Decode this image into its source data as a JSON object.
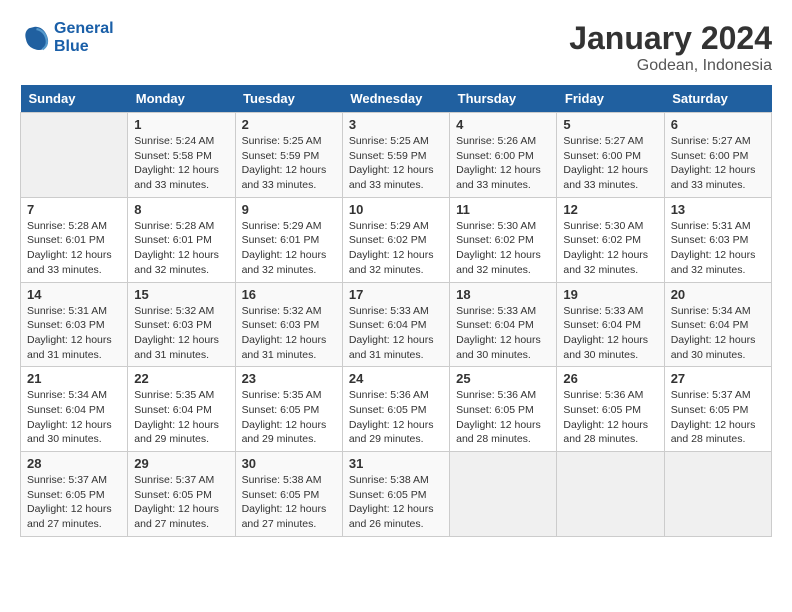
{
  "header": {
    "logo_line1": "General",
    "logo_line2": "Blue",
    "month": "January 2024",
    "location": "Godean, Indonesia"
  },
  "days_of_week": [
    "Sunday",
    "Monday",
    "Tuesday",
    "Wednesday",
    "Thursday",
    "Friday",
    "Saturday"
  ],
  "weeks": [
    [
      {
        "day": "",
        "info": ""
      },
      {
        "day": "1",
        "info": "Sunrise: 5:24 AM\nSunset: 5:58 PM\nDaylight: 12 hours\nand 33 minutes."
      },
      {
        "day": "2",
        "info": "Sunrise: 5:25 AM\nSunset: 5:59 PM\nDaylight: 12 hours\nand 33 minutes."
      },
      {
        "day": "3",
        "info": "Sunrise: 5:25 AM\nSunset: 5:59 PM\nDaylight: 12 hours\nand 33 minutes."
      },
      {
        "day": "4",
        "info": "Sunrise: 5:26 AM\nSunset: 6:00 PM\nDaylight: 12 hours\nand 33 minutes."
      },
      {
        "day": "5",
        "info": "Sunrise: 5:27 AM\nSunset: 6:00 PM\nDaylight: 12 hours\nand 33 minutes."
      },
      {
        "day": "6",
        "info": "Sunrise: 5:27 AM\nSunset: 6:00 PM\nDaylight: 12 hours\nand 33 minutes."
      }
    ],
    [
      {
        "day": "7",
        "info": "Sunrise: 5:28 AM\nSunset: 6:01 PM\nDaylight: 12 hours\nand 33 minutes."
      },
      {
        "day": "8",
        "info": "Sunrise: 5:28 AM\nSunset: 6:01 PM\nDaylight: 12 hours\nand 32 minutes."
      },
      {
        "day": "9",
        "info": "Sunrise: 5:29 AM\nSunset: 6:01 PM\nDaylight: 12 hours\nand 32 minutes."
      },
      {
        "day": "10",
        "info": "Sunrise: 5:29 AM\nSunset: 6:02 PM\nDaylight: 12 hours\nand 32 minutes."
      },
      {
        "day": "11",
        "info": "Sunrise: 5:30 AM\nSunset: 6:02 PM\nDaylight: 12 hours\nand 32 minutes."
      },
      {
        "day": "12",
        "info": "Sunrise: 5:30 AM\nSunset: 6:02 PM\nDaylight: 12 hours\nand 32 minutes."
      },
      {
        "day": "13",
        "info": "Sunrise: 5:31 AM\nSunset: 6:03 PM\nDaylight: 12 hours\nand 32 minutes."
      }
    ],
    [
      {
        "day": "14",
        "info": "Sunrise: 5:31 AM\nSunset: 6:03 PM\nDaylight: 12 hours\nand 31 minutes."
      },
      {
        "day": "15",
        "info": "Sunrise: 5:32 AM\nSunset: 6:03 PM\nDaylight: 12 hours\nand 31 minutes."
      },
      {
        "day": "16",
        "info": "Sunrise: 5:32 AM\nSunset: 6:03 PM\nDaylight: 12 hours\nand 31 minutes."
      },
      {
        "day": "17",
        "info": "Sunrise: 5:33 AM\nSunset: 6:04 PM\nDaylight: 12 hours\nand 31 minutes."
      },
      {
        "day": "18",
        "info": "Sunrise: 5:33 AM\nSunset: 6:04 PM\nDaylight: 12 hours\nand 30 minutes."
      },
      {
        "day": "19",
        "info": "Sunrise: 5:33 AM\nSunset: 6:04 PM\nDaylight: 12 hours\nand 30 minutes."
      },
      {
        "day": "20",
        "info": "Sunrise: 5:34 AM\nSunset: 6:04 PM\nDaylight: 12 hours\nand 30 minutes."
      }
    ],
    [
      {
        "day": "21",
        "info": "Sunrise: 5:34 AM\nSunset: 6:04 PM\nDaylight: 12 hours\nand 30 minutes."
      },
      {
        "day": "22",
        "info": "Sunrise: 5:35 AM\nSunset: 6:04 PM\nDaylight: 12 hours\nand 29 minutes."
      },
      {
        "day": "23",
        "info": "Sunrise: 5:35 AM\nSunset: 6:05 PM\nDaylight: 12 hours\nand 29 minutes."
      },
      {
        "day": "24",
        "info": "Sunrise: 5:36 AM\nSunset: 6:05 PM\nDaylight: 12 hours\nand 29 minutes."
      },
      {
        "day": "25",
        "info": "Sunrise: 5:36 AM\nSunset: 6:05 PM\nDaylight: 12 hours\nand 28 minutes."
      },
      {
        "day": "26",
        "info": "Sunrise: 5:36 AM\nSunset: 6:05 PM\nDaylight: 12 hours\nand 28 minutes."
      },
      {
        "day": "27",
        "info": "Sunrise: 5:37 AM\nSunset: 6:05 PM\nDaylight: 12 hours\nand 28 minutes."
      }
    ],
    [
      {
        "day": "28",
        "info": "Sunrise: 5:37 AM\nSunset: 6:05 PM\nDaylight: 12 hours\nand 27 minutes."
      },
      {
        "day": "29",
        "info": "Sunrise: 5:37 AM\nSunset: 6:05 PM\nDaylight: 12 hours\nand 27 minutes."
      },
      {
        "day": "30",
        "info": "Sunrise: 5:38 AM\nSunset: 6:05 PM\nDaylight: 12 hours\nand 27 minutes."
      },
      {
        "day": "31",
        "info": "Sunrise: 5:38 AM\nSunset: 6:05 PM\nDaylight: 12 hours\nand 26 minutes."
      },
      {
        "day": "",
        "info": ""
      },
      {
        "day": "",
        "info": ""
      },
      {
        "day": "",
        "info": ""
      }
    ]
  ]
}
